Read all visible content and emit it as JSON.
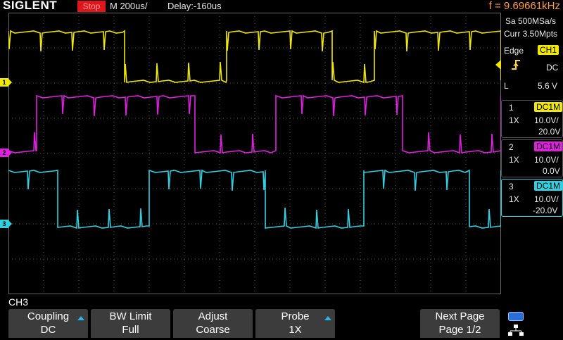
{
  "header": {
    "brand": "SIGLENT",
    "run_state": "Stop",
    "timebase": "M 200us/",
    "delay": "Delay:-160us",
    "frequency": "f = 9.69661kHz"
  },
  "acquisition": {
    "sample_rate": "Sa 500MSa/s",
    "memory": "Curr 3.50Mpts"
  },
  "trigger": {
    "type": "Edge",
    "source": "CH1",
    "coupling": "DC",
    "level_label": "L",
    "level": "5.6 V"
  },
  "channels": [
    {
      "id": "1",
      "coupling": "DC1M",
      "probe": "1X",
      "scale": "10.0V/",
      "offset": "20.0V",
      "color": "#f0e800"
    },
    {
      "id": "2",
      "coupling": "DC1M",
      "probe": "1X",
      "scale": "10.0V/",
      "offset": "0.0V",
      "color": "#e020e0"
    },
    {
      "id": "3",
      "coupling": "DC1M",
      "probe": "1X",
      "scale": "10.0V/",
      "offset": "-20.0V",
      "color": "#30d0e0"
    }
  ],
  "menu": {
    "title": "CH3",
    "softkeys": [
      {
        "label": "Coupling",
        "value": "DC"
      },
      {
        "label": "BW Limit",
        "value": "Full"
      },
      {
        "label": "Adjust",
        "value": "Coarse"
      },
      {
        "label": "Probe",
        "value": "1X"
      },
      {
        "label": "Next Page",
        "value": "Page 1/2"
      }
    ]
  },
  "icons": {
    "usb": "usb-icon",
    "network": "network-icon",
    "trigger_edge": "rising-edge-icon"
  }
}
